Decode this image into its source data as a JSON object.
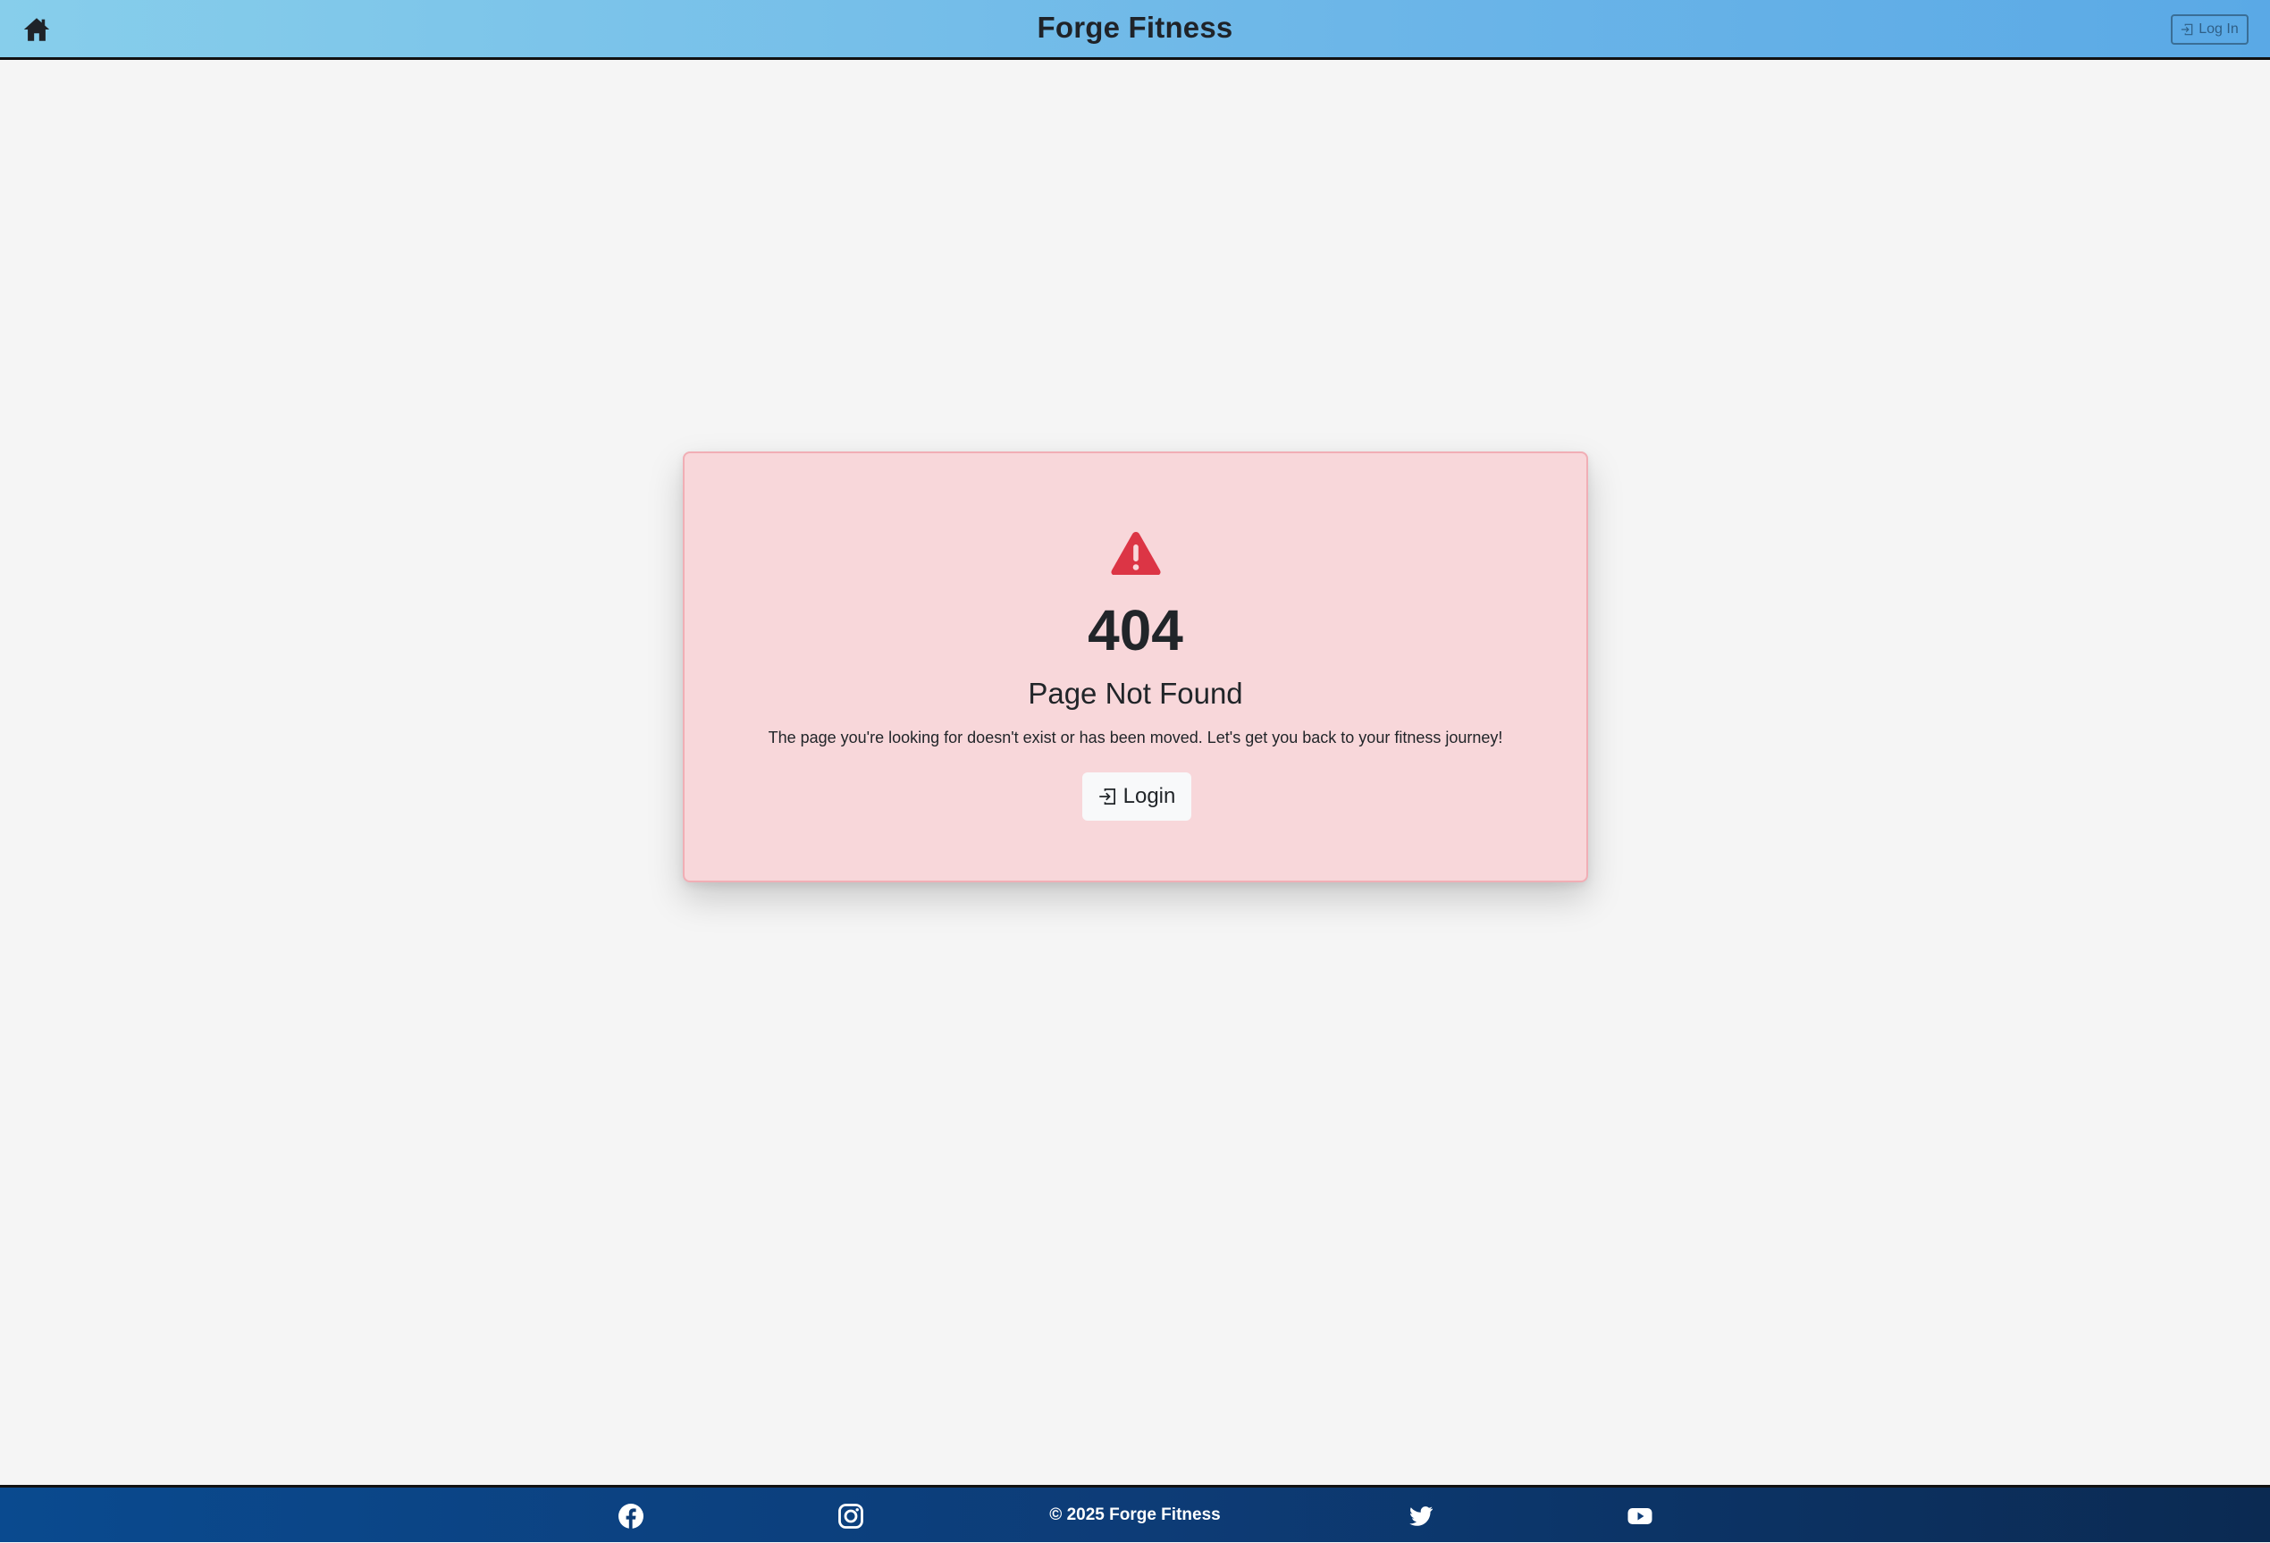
{
  "header": {
    "brand": "Forge Fitness",
    "login_label": "Log In",
    "home_icon": "home-icon",
    "login_icon": "login-icon"
  },
  "error_card": {
    "icon": "warning-triangle-icon",
    "code": "404",
    "title": "Page Not Found",
    "message": "The page you're looking for doesn't exist or has been moved. Let's get you back to your fitness journey!",
    "login_label": "Login",
    "login_icon": "login-icon"
  },
  "footer": {
    "copyright": "© 2025 Forge Fitness",
    "social_links": [
      {
        "icon": "facebook-icon"
      },
      {
        "icon": "instagram-icon"
      },
      {
        "icon": "twitter-icon"
      },
      {
        "icon": "youtube-icon"
      }
    ]
  },
  "colors": {
    "header_gradient_start": "#87ceeb",
    "header_gradient_end": "#5aa9e6",
    "card_background": "#f8d7da",
    "card_border": "#f1aeb5",
    "warning_red": "#dc3545",
    "footer_gradient_start": "#0a4a8f",
    "footer_gradient_end": "#0b2a52",
    "page_background": "#f5f5f5"
  }
}
